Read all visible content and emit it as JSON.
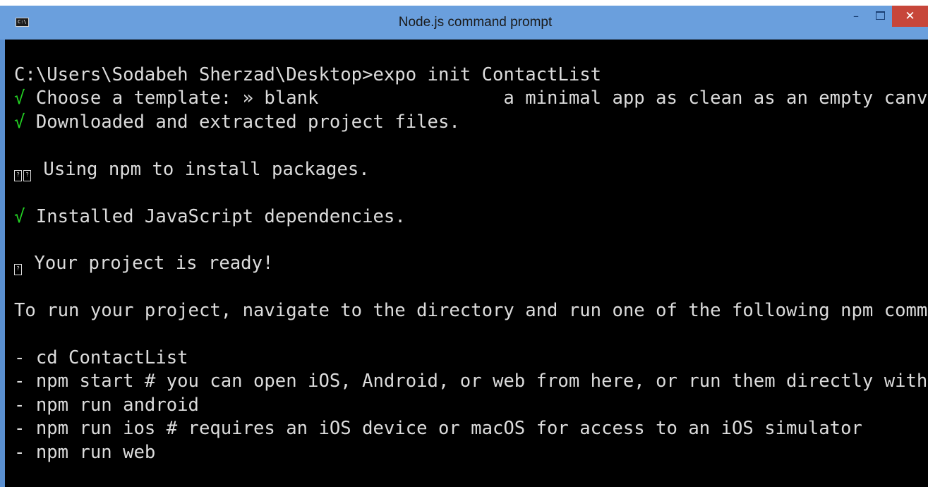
{
  "window": {
    "title": "Node.js command prompt",
    "icon": "cmd-icon",
    "icon_text": "C:\\",
    "controls": {
      "minimize": "–",
      "close": "✕"
    }
  },
  "console": {
    "lines": [
      {
        "text": "C:\\Users\\Sodabeh Sherzad\\Desktop>expo init ContactList"
      },
      {
        "check": "√",
        "text": " Choose a template: » blank                 a minimal app as clean as an empty canv"
      },
      {
        "check": "√",
        "text": " Downloaded and extracted project files."
      },
      {
        "glyph": "??",
        "text": " Using npm to install packages."
      },
      {
        "check": "√",
        "text": " Installed JavaScript dependencies."
      },
      {
        "glyph": "?",
        "text": " Your project is ready!"
      },
      {
        "text": "To run your project, navigate to the directory and run one of the following npm comm"
      },
      {
        "text": "- cd ContactList"
      },
      {
        "text": "- npm start # you can open iOS, Android, or web from here, or run them directly with"
      },
      {
        "text": "- npm run android"
      },
      {
        "text": "- npm run ios # requires an iOS device or macOS for access to an iOS simulator"
      },
      {
        "text": "- npm run web"
      }
    ]
  },
  "colors": {
    "titlebar": "#6a9fdd",
    "console_bg": "#000000",
    "console_fg": "#dcdcdc",
    "check": "#23d123",
    "close_button": "#c7463a"
  }
}
